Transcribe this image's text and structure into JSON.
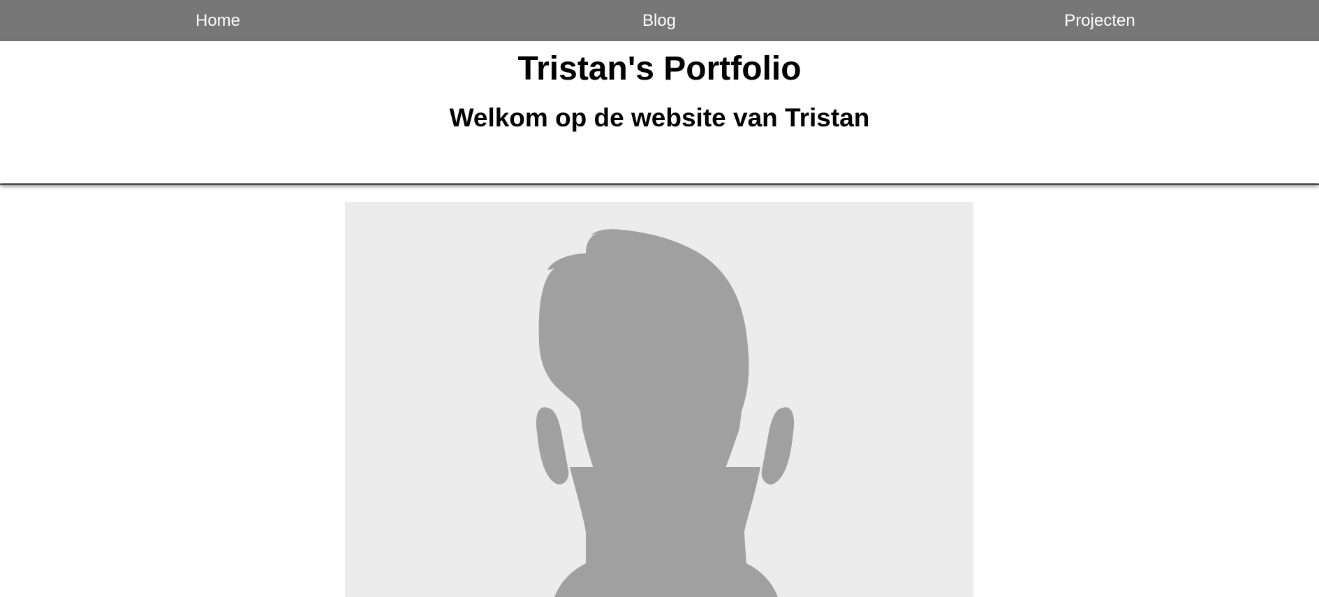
{
  "nav": {
    "items": [
      {
        "label": "Home"
      },
      {
        "label": "Blog"
      },
      {
        "label": "Projecten"
      }
    ],
    "background": "#777777",
    "text_color": "#ffffff"
  },
  "header": {
    "title": "Tristan's Portfolio",
    "subtitle": "Welkom op de website van Tristan"
  },
  "main": {
    "profile_image": {
      "icon": "person-silhouette-icon",
      "background": "#ececec",
      "silhouette_color": "#a0a0a0"
    }
  }
}
